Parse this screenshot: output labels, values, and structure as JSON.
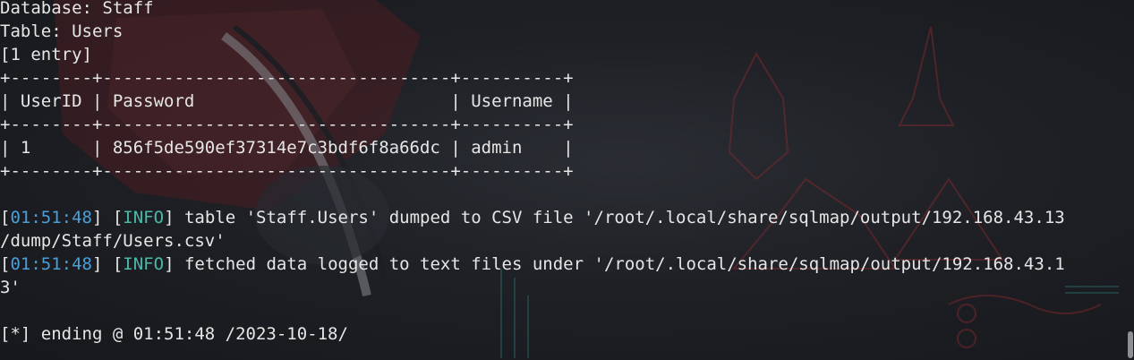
{
  "terminal": {
    "lines": [
      {
        "segments": [
          {
            "text": "Database: Staff"
          }
        ]
      },
      {
        "segments": [
          {
            "text": "Table: Users"
          }
        ]
      },
      {
        "segments": [
          {
            "text": "[1 entry]"
          }
        ]
      },
      {
        "segments": [
          {
            "text": "+--------+----------------------------------+----------+"
          }
        ]
      },
      {
        "segments": [
          {
            "text": "| UserID | Password                         | Username |"
          }
        ]
      },
      {
        "segments": [
          {
            "text": "+--------+----------------------------------+----------+"
          }
        ]
      },
      {
        "segments": [
          {
            "text": "| 1      | 856f5de590ef37314e7c3bdf6f8a66dc | admin    |"
          }
        ]
      },
      {
        "segments": [
          {
            "text": "+--------+----------------------------------+----------+"
          }
        ]
      },
      {
        "segments": [
          {
            "text": ""
          }
        ]
      },
      {
        "segments": [
          {
            "text": "[",
            "cls": "br"
          },
          {
            "text": "01:51:48",
            "cls": "ts"
          },
          {
            "text": "] [",
            "cls": "br"
          },
          {
            "text": "INFO",
            "cls": "lvl"
          },
          {
            "text": "] table 'Staff.Users' dumped to CSV file '/root/.local/share/sqlmap/output/192.168.43.13",
            "cls": "br"
          }
        ]
      },
      {
        "segments": [
          {
            "text": "/dump/Staff/Users.csv'"
          }
        ]
      },
      {
        "segments": [
          {
            "text": "[",
            "cls": "br"
          },
          {
            "text": "01:51:48",
            "cls": "ts"
          },
          {
            "text": "] [",
            "cls": "br"
          },
          {
            "text": "INFO",
            "cls": "lvl"
          },
          {
            "text": "] fetched data logged to text files under '/root/.local/share/sqlmap/output/192.168.43.1",
            "cls": "br"
          }
        ]
      },
      {
        "segments": [
          {
            "text": "3'"
          }
        ]
      },
      {
        "segments": [
          {
            "text": ""
          }
        ]
      },
      {
        "segments": [
          {
            "text": "[*] ending @ 01:51:48 /2023-10-18/"
          }
        ]
      }
    ]
  },
  "colors": {
    "timestamp": "#4a9fd8",
    "info_level": "#4bb9a8",
    "foreground": "#e6e6e6",
    "background": "#1b1d22"
  },
  "icons": {
    "scrollbar": "scrollbar-thumb"
  }
}
